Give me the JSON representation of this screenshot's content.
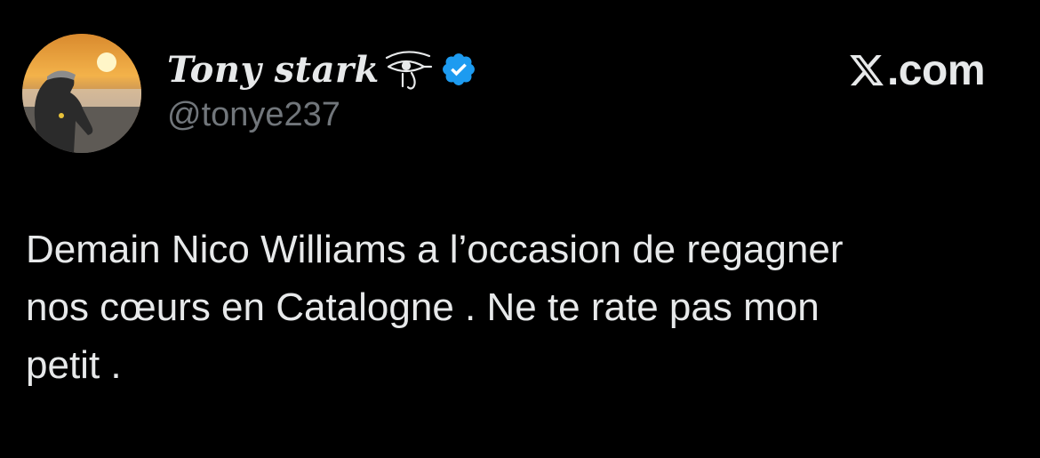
{
  "author": {
    "display_name": "Tony stark",
    "handle": "@tonye237",
    "avatar_icon": "user-avatar-sunset-photo",
    "name_emoji_icon": "eye-of-horus-icon",
    "verified_icon": "verified-badge-icon",
    "verified_color": "#1d9bf0"
  },
  "brand": {
    "logo_icon": "x-logo-icon",
    "text": ".com"
  },
  "tweet": {
    "text": "Demain Nico Williams a l’occasion de regagner\nnos cœurs en Catalogne . Ne te rate pas mon\npetit ."
  },
  "colors": {
    "background": "#000000",
    "text_primary": "#e7e9ea",
    "text_secondary": "#71767b"
  }
}
